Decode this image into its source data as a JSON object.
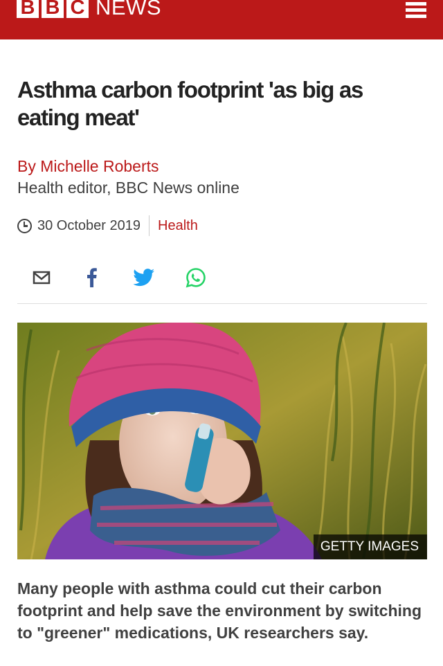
{
  "header": {
    "logo_letters": [
      "B",
      "B",
      "C"
    ],
    "logo_news": "NEWS",
    "brand_color": "#bb1919"
  },
  "article": {
    "headline": "Asthma carbon footprint 'as big as eating meat'",
    "byline": {
      "name": "By Michelle Roberts",
      "role": "Health editor, BBC News online"
    },
    "date": "30 October 2019",
    "topic": "Health",
    "share_icons": [
      "email-icon",
      "facebook-icon",
      "twitter-icon",
      "whatsapp-icon"
    ],
    "image": {
      "description_icon": "child-using-inhaler-photo",
      "credit": "GETTY IMAGES"
    },
    "intro": "Many people with asthma could cut their carbon footprint and help save the environment by switching to \"greener\" medications, UK researchers say."
  },
  "colors": {
    "accent": "#bb1919",
    "text": "#222222",
    "secondary_text": "#404040",
    "facebook": "#3b5998",
    "twitter": "#1da1f2",
    "whatsapp": "#25d366"
  }
}
